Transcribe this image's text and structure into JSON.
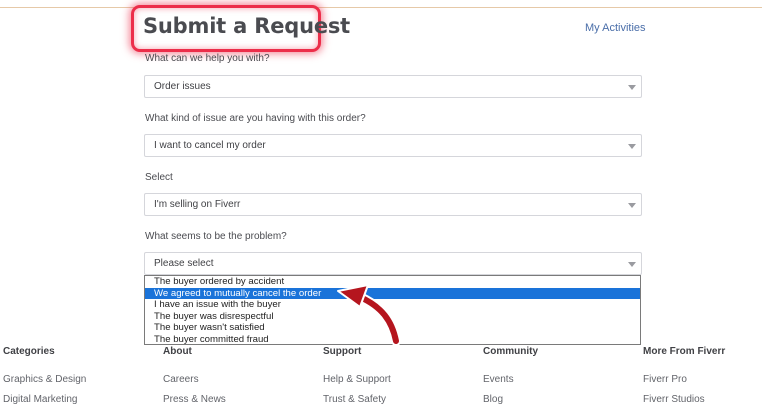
{
  "header": {
    "title": "Submit a Request",
    "my_activities": "My Activities",
    "highlight_color": "#ec2e4a"
  },
  "form": {
    "q1_label": "What can we help you with?",
    "q1_value": "Order issues",
    "q2_label": "What kind of issue are you having with this order?",
    "q2_value": "I want to cancel my order",
    "q3_label": "Select",
    "q3_value": "I'm selling on Fiverr",
    "q4_label": "What seems to be the problem?",
    "q4_value": "Please select",
    "dropdown_options": [
      "The buyer ordered by accident",
      "We agreed to mutually cancel the order",
      "I have an issue with the buyer",
      "The buyer was disrespectful",
      "The buyer wasn't satisfied",
      "The buyer committed fraud"
    ],
    "selected_option_index": 1,
    "selection_color": "#1a73d9",
    "arrow_color": "#b5151e"
  },
  "footer": {
    "columns": [
      {
        "heading": "Categories",
        "links": [
          "Graphics & Design",
          "Digital Marketing"
        ]
      },
      {
        "heading": "About",
        "links": [
          "Careers",
          "Press & News"
        ]
      },
      {
        "heading": "Support",
        "links": [
          "Help & Support",
          "Trust & Safety"
        ]
      },
      {
        "heading": "Community",
        "links": [
          "Events",
          "Blog"
        ]
      },
      {
        "heading": "More From Fiverr",
        "links": [
          "Fiverr Pro",
          "Fiverr Studios"
        ]
      }
    ]
  }
}
